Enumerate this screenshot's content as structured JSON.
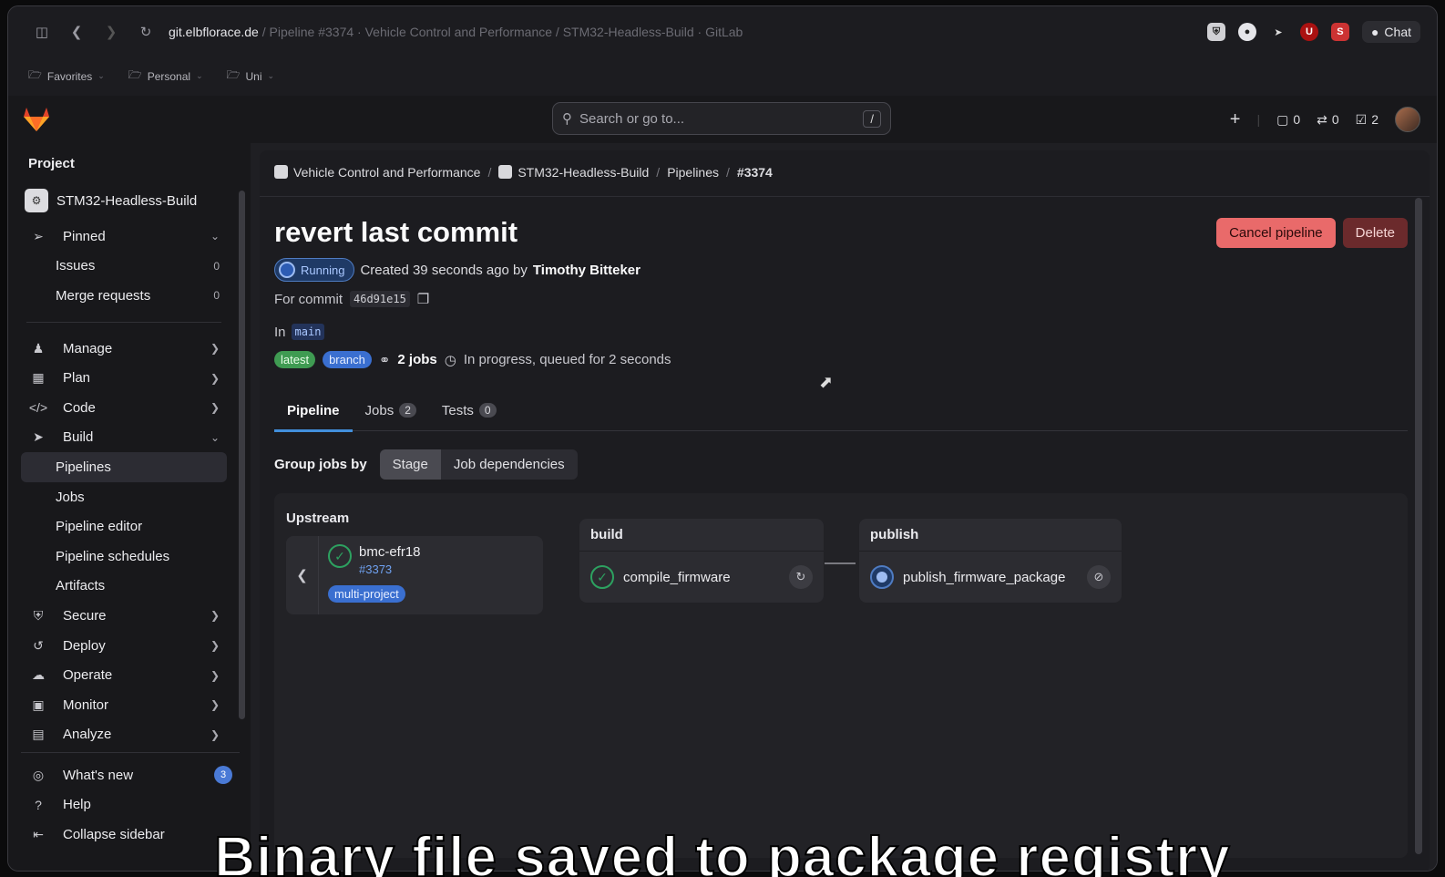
{
  "browser": {
    "url_host": "git.elbflorace.de",
    "url_rest": " / Pipeline #3374 · Vehicle Control and Performance / STM32-Headless-Build · GitLab",
    "chat_label": "Chat",
    "bookmarks": [
      "Favorites",
      "Personal",
      "Uni"
    ]
  },
  "topbar": {
    "search_placeholder": "Search or go to...",
    "search_shortcut": "/",
    "issues_count": "0",
    "mr_count": "0",
    "todo_count": "2"
  },
  "sidebar": {
    "section_title": "Project",
    "project_name": "STM32-Headless-Build",
    "pinned_label": "Pinned",
    "pinned": [
      {
        "label": "Issues",
        "count": "0"
      },
      {
        "label": "Merge requests",
        "count": "0"
      }
    ],
    "groups": [
      "Manage",
      "Plan",
      "Code",
      "Build"
    ],
    "build_items": [
      "Pipelines",
      "Jobs",
      "Pipeline editor",
      "Pipeline schedules",
      "Artifacts"
    ],
    "more_groups": [
      "Secure",
      "Deploy",
      "Operate",
      "Monitor",
      "Analyze"
    ],
    "whats_new": "What's new",
    "whats_new_count": "3",
    "help": "Help",
    "collapse": "Collapse sidebar"
  },
  "breadcrumb": {
    "group": "Vehicle Control and Performance",
    "project": "STM32-Headless-Build",
    "section": "Pipelines",
    "current": "#3374"
  },
  "pipeline": {
    "title": "revert last commit",
    "cancel_label": "Cancel pipeline",
    "delete_label": "Delete",
    "status": "Running",
    "created_text": "Created 39 seconds ago by",
    "author": "Timothy Bitteker",
    "for_commit_label": "For commit",
    "commit_sha": "46d91e15",
    "in_label": "In",
    "branch": "main",
    "tag_latest": "latest",
    "tag_branch": "branch",
    "jobs_text": "2 jobs",
    "progress_text": "In progress, queued for 2 seconds"
  },
  "tabs": [
    {
      "label": "Pipeline",
      "count": ""
    },
    {
      "label": "Jobs",
      "count": "2"
    },
    {
      "label": "Tests",
      "count": "0"
    }
  ],
  "group_by": {
    "label": "Group jobs by",
    "options": [
      "Stage",
      "Job dependencies"
    ],
    "selected": "Stage"
  },
  "graph": {
    "upstream_label": "Upstream",
    "upstream": {
      "name": "bmc-efr18",
      "id": "#3373",
      "tag": "multi-project"
    },
    "stages": [
      {
        "name": "build",
        "job": "compile_firmware",
        "status": "success",
        "action": "retry-icon"
      },
      {
        "name": "publish",
        "job": "publish_firmware_package",
        "status": "running",
        "action": "cancel-icon"
      }
    ]
  },
  "caption": "Binary file saved to package registry",
  "colors": {
    "accent": "#428fdc",
    "success": "#2da160",
    "danger": "#e96a6a"
  }
}
